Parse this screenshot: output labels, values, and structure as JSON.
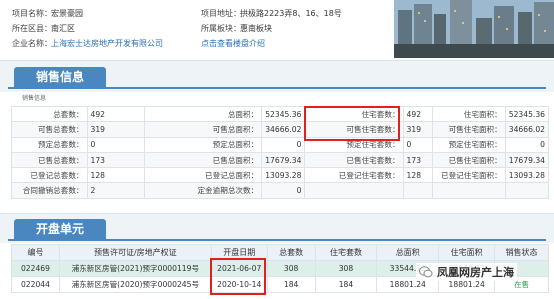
{
  "project": {
    "name_label": "项目名称：",
    "name_value": "宏景豪园",
    "district_label": "所在区县：",
    "district_value": "南汇区",
    "developer_label": "企业名称：",
    "developer_value": "上海宏士达房地产开发有限公司",
    "address_label": "项目地址：",
    "address_value": "拱极路2223弄8、16、18号",
    "sector_label": "所属板块：",
    "sector_value": "惠南板块",
    "intro_link": "点击查看楼盘介绍"
  },
  "sales_info": {
    "title": "销售信息",
    "subtitle": "销售信息",
    "rows": [
      [
        "总套数：",
        "492",
        "总面积：",
        "52345.36",
        "住宅套数：",
        "492",
        "住宅面积：",
        "52345.36"
      ],
      [
        "可售总套数：",
        "319",
        "可售总面积：",
        "34666.02",
        "可售住宅套数：",
        "319",
        "可售住宅面积：",
        "34666.02"
      ],
      [
        "预定总套数：",
        "0",
        "预定总面积：",
        "0",
        "预定住宅套数：",
        "0",
        "预定住宅面积：",
        "0"
      ],
      [
        "已售总套数：",
        "173",
        "已售总面积：",
        "17679.34",
        "已售住宅套数：",
        "173",
        "已售住宅面积：",
        "17679.34"
      ],
      [
        "已登记总套数：",
        "128",
        "已登记总面积：",
        "13093.28",
        "已登记住宅套数：",
        "128",
        "已登记住宅面积：",
        "13093.28"
      ],
      [
        "合同撤销总套数：",
        "2",
        "定金逾期总次数：",
        "0",
        "",
        "",
        "",
        ""
      ]
    ]
  },
  "units": {
    "title": "开盘单元",
    "headers": [
      "编号",
      "预售许可证/房地产权证",
      "开盘日期",
      "总套数",
      "住宅套数",
      "总面积",
      "住宅面积",
      "销售状态"
    ],
    "rows": [
      [
        "022469",
        "浦东新区房管(2021)预字0000119号",
        "2021-06-07",
        "308",
        "308",
        "33544.12",
        "33544.12",
        ""
      ],
      [
        "022044",
        "浦东新区房管(2020)预字0000245号",
        "2020-10-14",
        "184",
        "184",
        "18801.24",
        "18801.24",
        "在售"
      ]
    ]
  },
  "watermark": "凤凰网房产上海",
  "colors": {
    "accent": "#4a87c0",
    "highlight": "#e02020",
    "link": "#2a6fb8",
    "status": "#2e9a55"
  }
}
